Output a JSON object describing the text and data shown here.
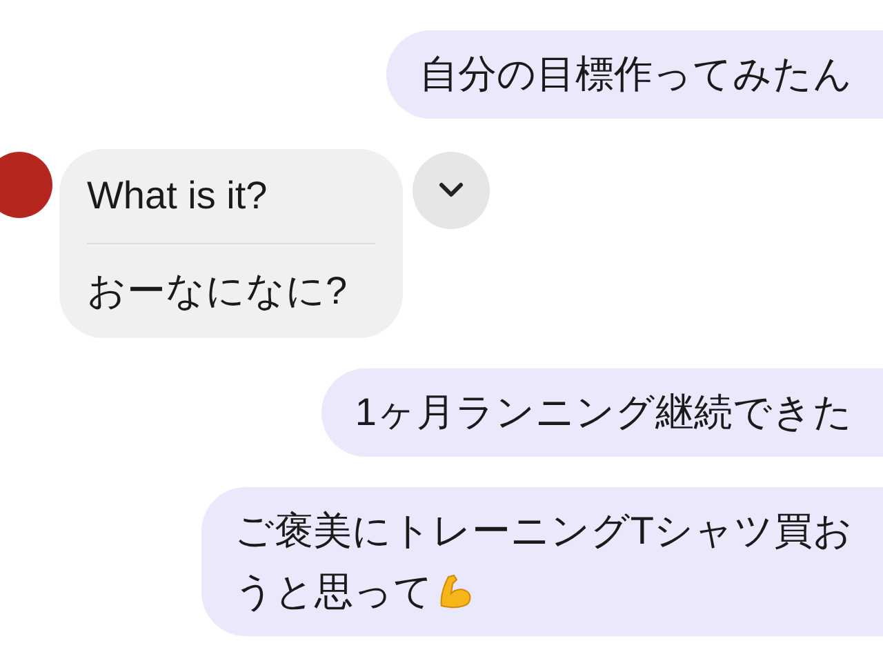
{
  "messages": [
    {
      "kind": "outgoing",
      "lines": [
        "自分の目標作ってみたん"
      ],
      "emoji": false
    },
    {
      "kind": "incoming",
      "original": "What is it?",
      "translation": "おーなになに?"
    },
    {
      "kind": "outgoing",
      "lines": [
        "1ヶ月ランニング継続できた"
      ],
      "emoji": false
    },
    {
      "kind": "outgoing",
      "lines": [
        "ご褒美にトレーニングTシャツ買お",
        "うと思って"
      ],
      "emoji": true
    }
  ]
}
